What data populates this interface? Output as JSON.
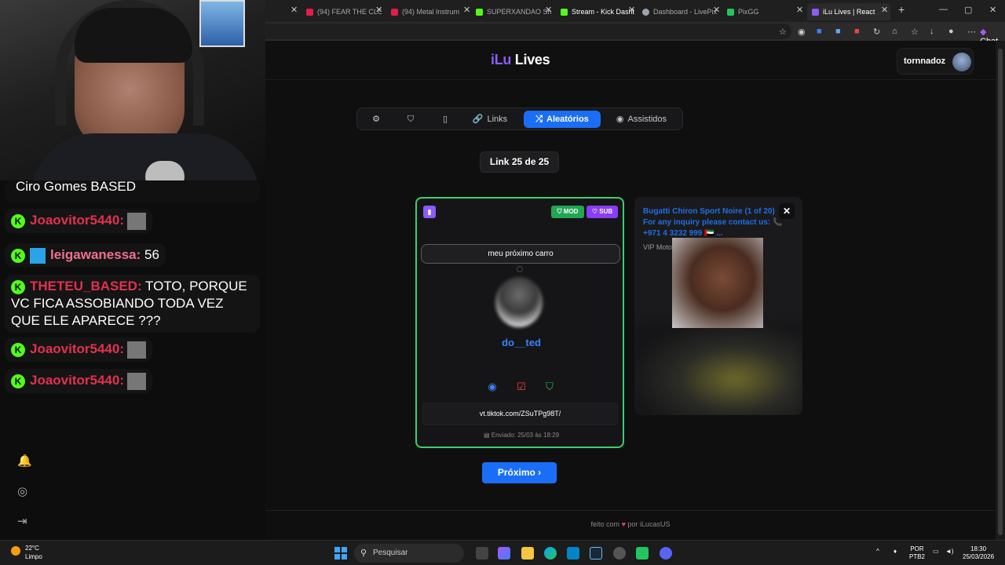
{
  "chat": {
    "top_message": "Ciro Gomes BASED",
    "messages": [
      {
        "user": "Joaovitor5440:",
        "text": ""
      },
      {
        "user": "leigawanessa:",
        "text": "56"
      },
      {
        "user": "THETEU_BASED:",
        "text": "TOTO, PORQUE VC FICA ASSOBIANDO TODA VEZ QUE ELE APARECE ???"
      },
      {
        "user": "Joaovitor5440:",
        "text": ""
      },
      {
        "user": "Joaovitor5440:",
        "text": ""
      }
    ]
  },
  "browser": {
    "tabs": [
      {
        "label": "(94) FEAR THE CLO",
        "color": "#e11d48"
      },
      {
        "label": "(94) Metal Instrum",
        "color": "#e11d48"
      },
      {
        "label": "SUPERXANDAO Sh",
        "color": "#53fc18"
      },
      {
        "label": "Stream - Kick Dashb",
        "color": "#53fc18"
      },
      {
        "label": "Dashboard - LivePix",
        "color": "#9ca3af"
      },
      {
        "label": "PixGG",
        "color": "#22c55e"
      },
      {
        "label": "iLu Lives | React",
        "color": "#8b5cf6"
      }
    ],
    "chat_button": "Chat"
  },
  "app": {
    "logo_prefix": "iLu",
    "logo_suffix": "Lives",
    "username": "tornnadoz",
    "nav": {
      "links_label": "Links",
      "random_label": "Aleatórios",
      "watched_label": "Assistidos"
    },
    "counter": "Link 25 de 25",
    "card": {
      "mod_badge": "MOD",
      "sub_badge": "SUB",
      "message": "meu próximo carro",
      "author": "do__ted",
      "link": "vt.tiktok.com/ZSuTPg98T/",
      "sent": "Enviado: 25/03 às 18:29"
    },
    "preview": {
      "title": "Bugatti Chiron Sport Noire (1 of 20) For any inquiry please contact us: 📞 +971 4 3232 999 🇦🇪 ...",
      "subtitle": "VIP Moto"
    },
    "next_button": "Próximo ›",
    "footer_prefix": "feito com",
    "footer_suffix": "por iLucasUS"
  },
  "taskbar": {
    "temp": "22°C",
    "weather": "Limpo",
    "search_placeholder": "Pesquisar",
    "lang": "POR",
    "layout": "PTB2",
    "time": "18:30",
    "date": "25/03/2026"
  }
}
